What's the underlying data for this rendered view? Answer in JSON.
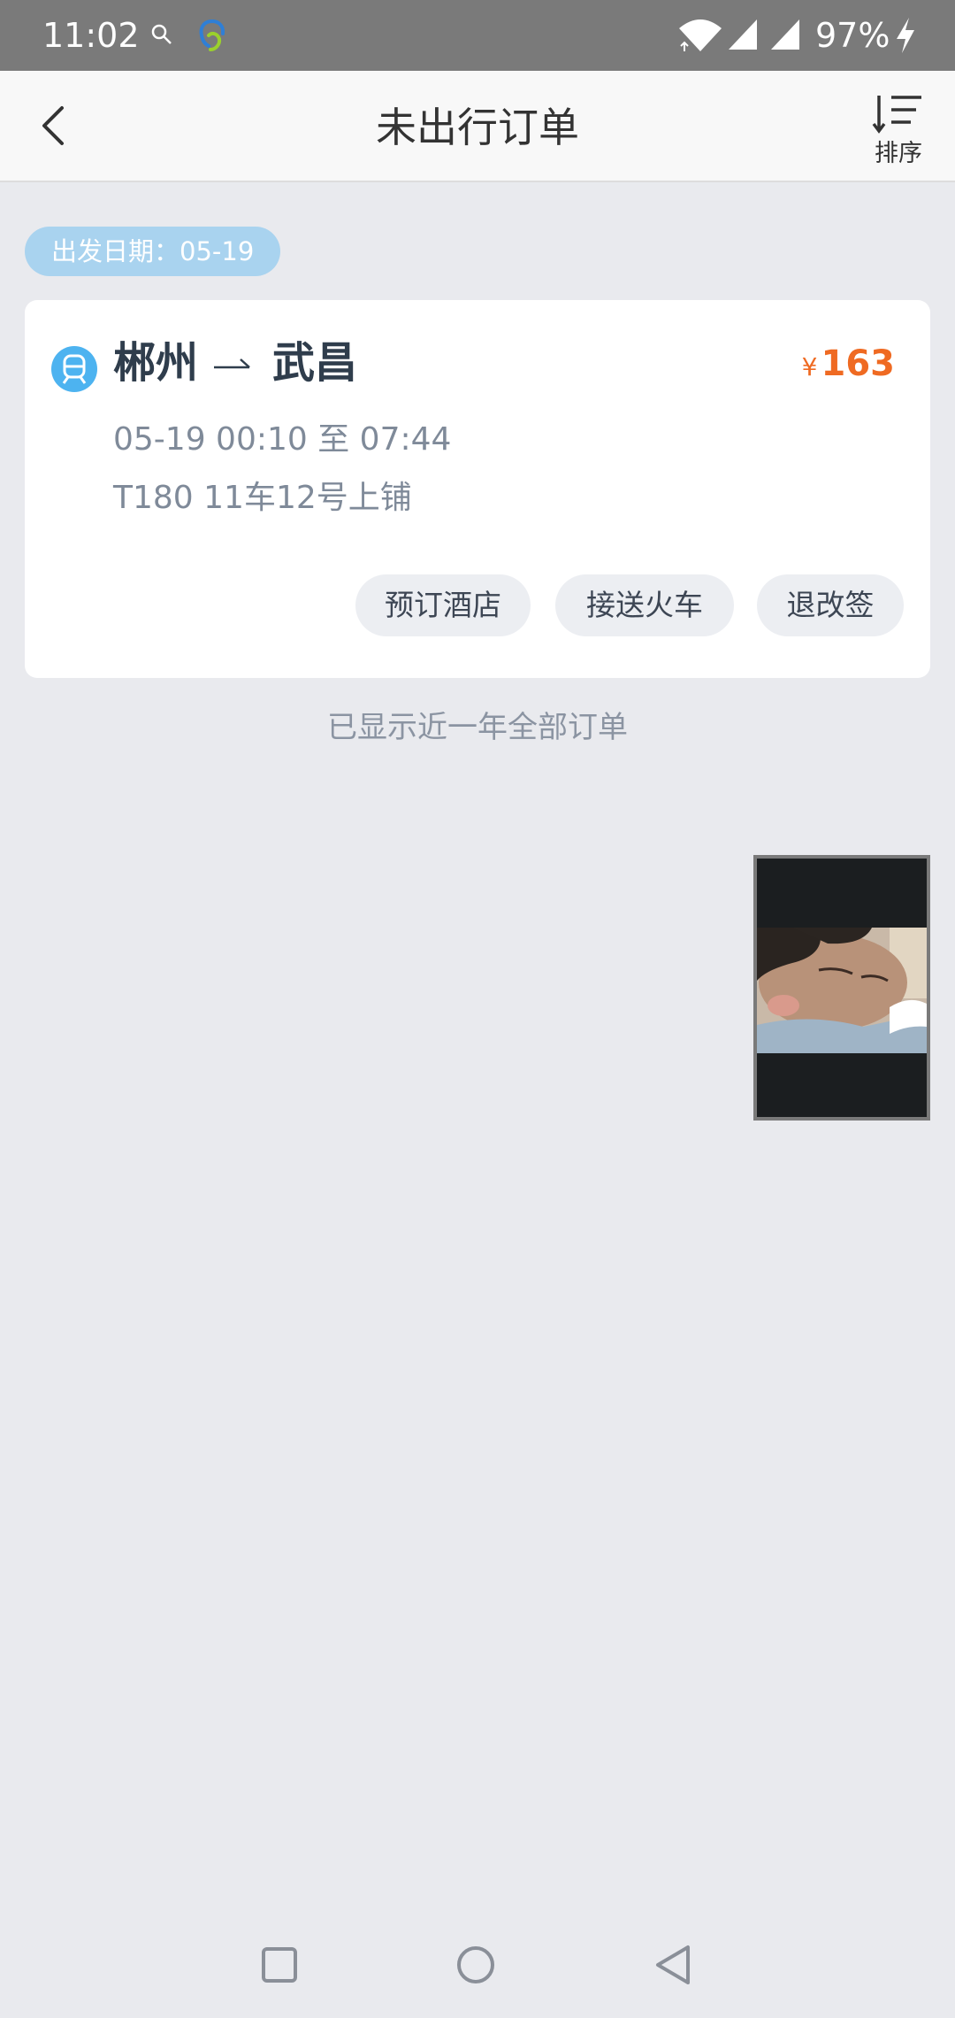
{
  "status_bar": {
    "time": "11:02",
    "battery": "97%",
    "icons": [
      "search-icon",
      "app-notification-icon",
      "wifi-icon",
      "signal-icon",
      "signal-icon",
      "charging-icon"
    ]
  },
  "header": {
    "title": "未出行订单",
    "sort_label": "排序",
    "icons": [
      "back-icon",
      "sort-icon"
    ]
  },
  "date_tag": "出发日期：05-19",
  "order": {
    "from": "郴州",
    "to": "武昌",
    "currency": "¥",
    "price": "163",
    "time": "05-19 00:10 至 07:44",
    "seat": "T180 11车12号上铺",
    "actions": {
      "hotel": "预订酒店",
      "transfer": "接送火车",
      "change": "退改签"
    },
    "icon": "train-icon"
  },
  "footer_note": "已显示近一年全部订单",
  "nav_bar": {
    "icons": [
      "recents-icon",
      "home-icon",
      "back-icon"
    ]
  },
  "colors": {
    "accent_price": "#ef6a22",
    "tag_background": "#a9d3ef",
    "train_icon": "#4db3f0",
    "page_background": "#e9eaee"
  }
}
